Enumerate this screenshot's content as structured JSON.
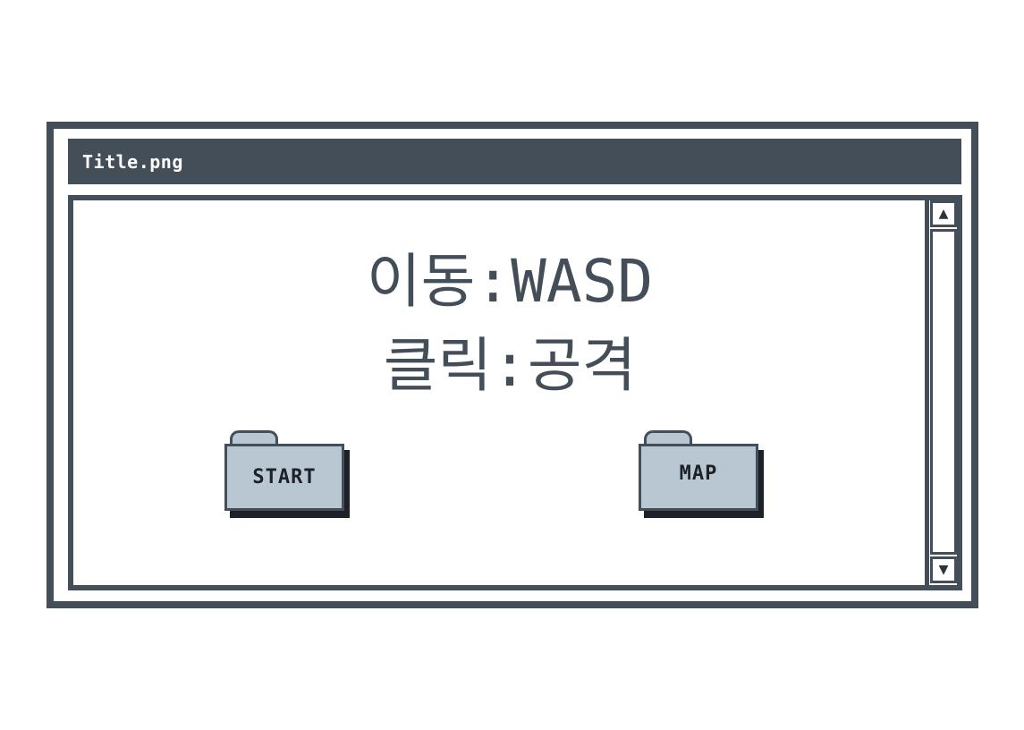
{
  "window": {
    "title": "Title.png"
  },
  "instructions": {
    "line1": "이동:WASD",
    "line2": "클릭:공격"
  },
  "buttons": {
    "start_label": "START",
    "map_label": "MAP"
  },
  "scrollbar": {
    "up_icon": "▲",
    "down_icon": "▼"
  },
  "colors": {
    "frame": "#444e58",
    "folder_fill": "#b9c7d3",
    "folder_shadow": "#1c2228",
    "background": "#ffffff"
  }
}
